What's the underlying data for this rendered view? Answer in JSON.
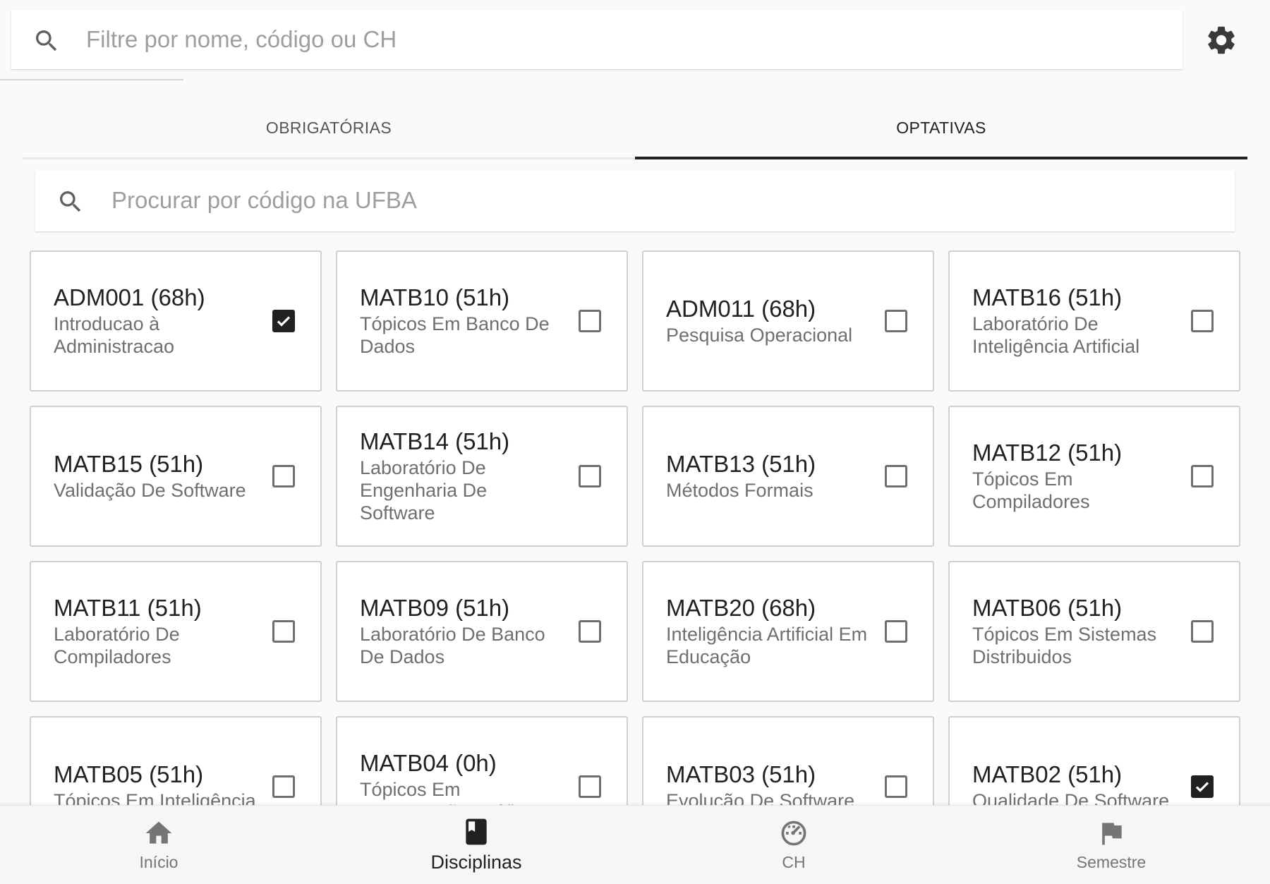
{
  "search": {
    "placeholder": "Filtre por nome, código ou CH"
  },
  "tabs": [
    {
      "label": "OBRIGATÓRIAS",
      "active": false
    },
    {
      "label": "OPTATIVAS",
      "active": true
    }
  ],
  "ufba_search": {
    "placeholder": "Procurar por código na UFBA"
  },
  "courses": [
    {
      "code": "ADM001 (68h)",
      "name": "Introducao à Administracao",
      "checked": true
    },
    {
      "code": "MATB10 (51h)",
      "name": "Tópicos Em Banco De Dados",
      "checked": false
    },
    {
      "code": "ADM011 (68h)",
      "name": "Pesquisa Operacional",
      "checked": false
    },
    {
      "code": "MATB16 (51h)",
      "name": "Laboratório De Inteligência Artificial",
      "checked": false
    },
    {
      "code": "MATB15 (51h)",
      "name": "Validação De Software",
      "checked": false
    },
    {
      "code": "MATB14 (51h)",
      "name": "Laboratório De Engenharia De Software",
      "checked": false
    },
    {
      "code": "MATB13 (51h)",
      "name": "Métodos Formais",
      "checked": false
    },
    {
      "code": "MATB12 (51h)",
      "name": "Tópicos Em Compiladores",
      "checked": false
    },
    {
      "code": "MATB11 (51h)",
      "name": "Laboratório De Compiladores",
      "checked": false
    },
    {
      "code": "MATB09 (51h)",
      "name": "Laboratório De Banco De Dados",
      "checked": false
    },
    {
      "code": "MATB20 (68h)",
      "name": "Inteligência Artificial Em Educação",
      "checked": false
    },
    {
      "code": "MATB06 (51h)",
      "name": "Tópicos Em Sistemas Distribuidos",
      "checked": false
    },
    {
      "code": "MATB05 (51h)",
      "name": "Tópicos Em Inteligência",
      "checked": false
    },
    {
      "code": "MATB04 (0h)",
      "name": "Tópicos Em Computação Gráfica E",
      "checked": false
    },
    {
      "code": "MATB03 (51h)",
      "name": "Evolução De Software",
      "checked": false
    },
    {
      "code": "MATB02 (51h)",
      "name": "Qualidade De Software",
      "checked": true
    }
  ],
  "bottom_nav": [
    {
      "label": "Início",
      "icon": "home-icon",
      "active": false
    },
    {
      "label": "Disciplinas",
      "icon": "book-icon",
      "active": true
    },
    {
      "label": "CH",
      "icon": "speedometer-icon",
      "active": false
    },
    {
      "label": "Semestre",
      "icon": "flag-icon",
      "active": false
    }
  ],
  "colors": {
    "accent": "#212121",
    "muted": "#757575",
    "background": "#fafafa"
  }
}
